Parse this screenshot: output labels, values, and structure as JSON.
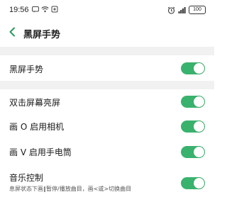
{
  "status_bar": {
    "time": "19:56",
    "battery": "100"
  },
  "header": {
    "title": "黑屏手势"
  },
  "settings": [
    {
      "label": "黑屏手势",
      "enabled": true
    },
    {
      "label": "双击屏幕亮屏",
      "enabled": true
    },
    {
      "label": "画 O 启用相机",
      "enabled": true
    },
    {
      "label": "画 V 启用手电筒",
      "enabled": true
    },
    {
      "label": "音乐控制",
      "sublabel": "息屏状态下画‖暂停/播放曲目，画<或>切换曲目",
      "enabled": true
    }
  ],
  "colors": {
    "toggle_on": "#39b26d",
    "accent": "#2b9a5b",
    "band": "#f1f1f1"
  }
}
